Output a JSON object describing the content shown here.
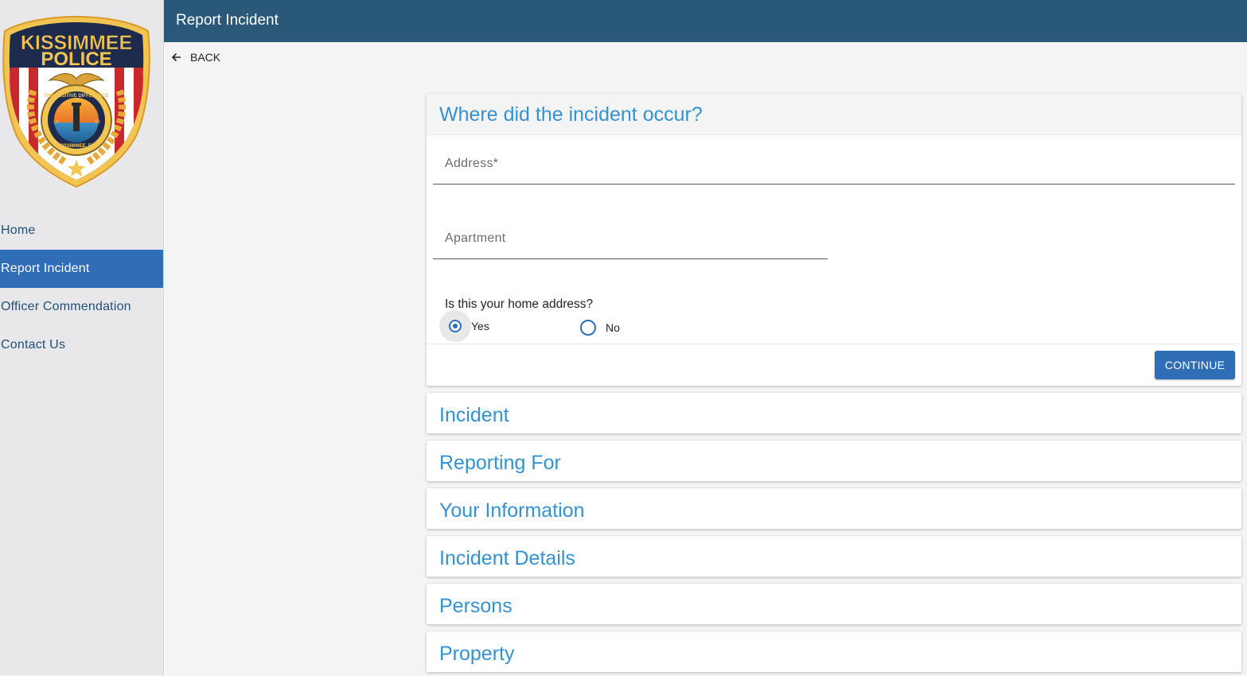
{
  "sidebar": {
    "logo": {
      "text_top": "KISSIMMEE",
      "text_main": "POLICE",
      "motto": "THE POSITIVE DIFFERENCE",
      "location": "KISSIMMEE, FL",
      "year_left": "18",
      "year_right": "83"
    },
    "items": [
      {
        "label": "Home",
        "active": false
      },
      {
        "label": "Report Incident",
        "active": true
      },
      {
        "label": "Officer Commendation",
        "active": false
      },
      {
        "label": "Contact Us",
        "active": false
      }
    ]
  },
  "header": {
    "title": "Report Incident"
  },
  "back": {
    "label": "BACK"
  },
  "location_step": {
    "title": "Where did the incident occur?",
    "address": {
      "label": "Address*",
      "value": ""
    },
    "apartment": {
      "label": "Apartment",
      "value": ""
    },
    "home_question": "Is this your home address?",
    "options": [
      {
        "label": "Yes",
        "checked": true
      },
      {
        "label": "No",
        "checked": false
      }
    ],
    "continue_label": "CONTINUE"
  },
  "sections": [
    {
      "title": "Incident"
    },
    {
      "title": "Reporting For"
    },
    {
      "title": "Your Information"
    },
    {
      "title": "Incident Details"
    },
    {
      "title": "Persons"
    },
    {
      "title": "Property"
    }
  ],
  "colors": {
    "header_bg": "#2a5878",
    "accent": "#2f6db7",
    "section_title": "#3592cf"
  }
}
